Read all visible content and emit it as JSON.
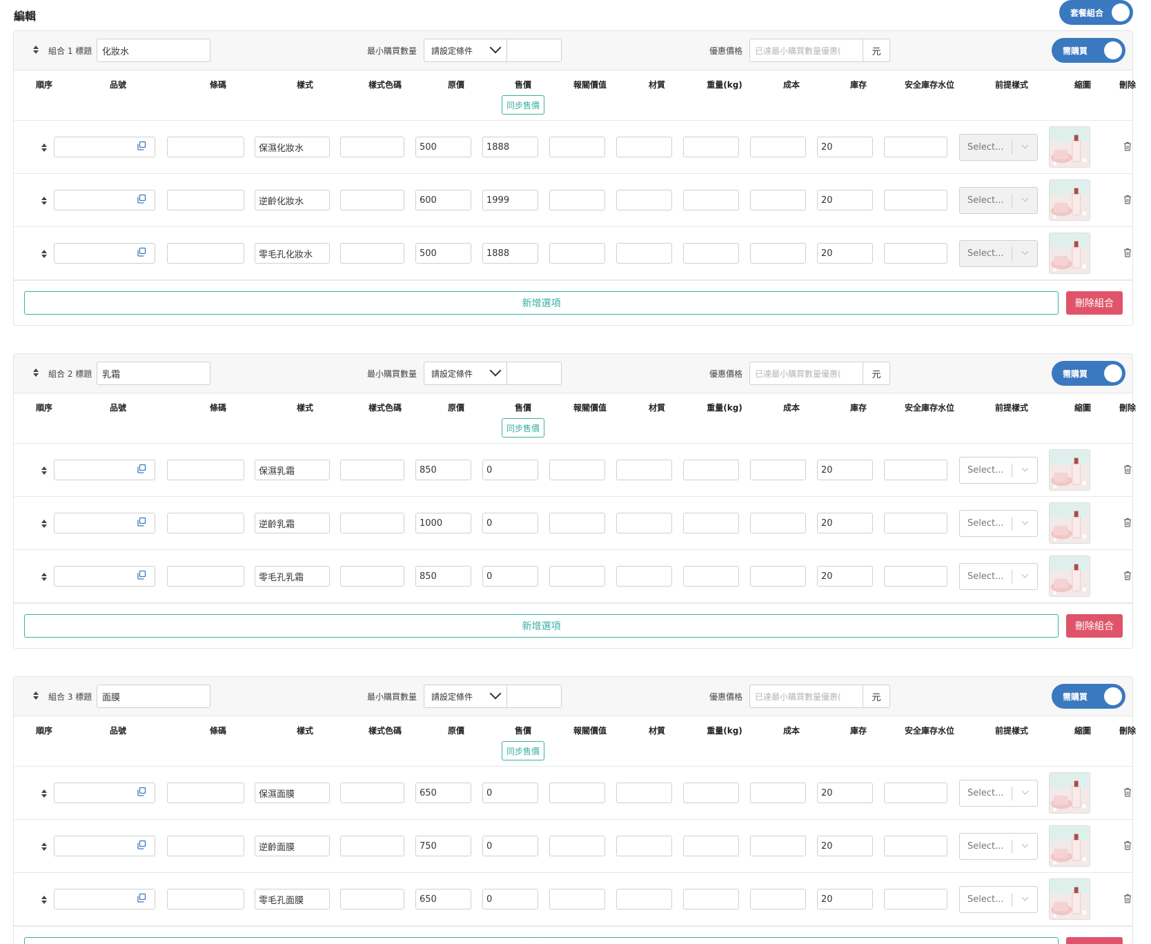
{
  "page": {
    "title": "編輯",
    "combo_toggle": "套餐組合"
  },
  "labels": {
    "title_prefix": "組合",
    "title_suffix": "標題",
    "min_qty": "最小購買數量",
    "min_qty_select": "請設定條件",
    "discount": "優惠價格",
    "discount_placeholder": "已達最小購買數量優惠(",
    "unit": "元",
    "required": "需購買",
    "sync_price": "同步售價",
    "select_placeholder": "Select...",
    "add_option": "新增選項",
    "delete_combo": "刪除組合"
  },
  "columns": [
    "順序",
    "品號",
    "條碼",
    "樣式",
    "樣式色碼",
    "原價",
    "售價",
    "報關價值",
    "材質",
    "重量(kg)",
    "成本",
    "庫存",
    "安全庫存水位",
    "前提樣式",
    "縮圖",
    "刪除"
  ],
  "combos": [
    {
      "index": "1",
      "title": "化妝水",
      "select_disabled": true,
      "rows": [
        {
          "style": "保濕化妝水",
          "orig": "500",
          "price": "1888",
          "stock": "20"
        },
        {
          "style": "逆齡化妝水",
          "orig": "600",
          "price": "1999",
          "stock": "20"
        },
        {
          "style": "零毛孔化妝水",
          "orig": "500",
          "price": "1888",
          "stock": "20"
        }
      ]
    },
    {
      "index": "2",
      "title": "乳霜",
      "select_disabled": false,
      "rows": [
        {
          "style": "保濕乳霜",
          "orig": "850",
          "price": "0",
          "stock": "20"
        },
        {
          "style": "逆齡乳霜",
          "orig": "1000",
          "price": "0",
          "stock": "20"
        },
        {
          "style": "零毛孔乳霜",
          "orig": "850",
          "price": "0",
          "stock": "20"
        }
      ]
    },
    {
      "index": "3",
      "title": "面膜",
      "select_disabled": false,
      "rows": [
        {
          "style": "保濕面膜",
          "orig": "650",
          "price": "0",
          "stock": "20"
        },
        {
          "style": "逆齡面膜",
          "orig": "750",
          "price": "0",
          "stock": "20"
        },
        {
          "style": "零毛孔面膜",
          "orig": "650",
          "price": "0",
          "stock": "20"
        }
      ]
    }
  ],
  "colors": {
    "primary": "#3a78c0",
    "teal": "#36b0a0",
    "danger": "#e0546a"
  },
  "icons": {
    "sort": "sort-icon",
    "copy": "copy-icon",
    "trash": "trash-icon",
    "thumbnail": "product-thumbnail"
  }
}
